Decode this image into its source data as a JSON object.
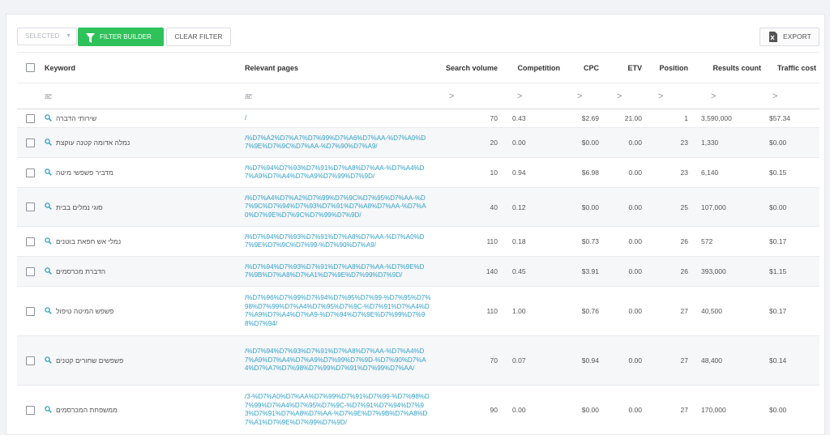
{
  "toolbar": {
    "selected_label": "SELECTED",
    "filter_builder_label": "FILTER BUILDER",
    "clear_filter_label": "CLEAR FILTER",
    "export_label": "EXPORT"
  },
  "columns": {
    "keyword": "Keyword",
    "relevant_pages": "Relevant pages",
    "search_volume": "Search volume",
    "competition": "Competition",
    "cpc": "CPC",
    "etv": "ETV",
    "position": "Position",
    "results_count": "Results count",
    "traffic_cost": "Traffic cost"
  },
  "filters": {
    "text_glyph": "a͞c",
    "num_glyph": ">"
  },
  "colors": {
    "accent_green": "#2fc25b",
    "link_blue": "#2f9fc6"
  },
  "rows": [
    {
      "keyword": "שירותי הדברה",
      "page": "/",
      "search_volume": "70",
      "competition": "0.43",
      "cpc": "$2.69",
      "etv": "21.00",
      "position": "1",
      "results_count": "3,590,000",
      "traffic_cost": "$57.34"
    },
    {
      "keyword": "נמלה אדומה קטנה עוקצת",
      "page": "/%D7%A2%D7%A7%D7%99%D7%A6%D7%AA-%D7%A0%D7%9E%D7%9C%D7%AA-%D7%90%D7%A9/",
      "search_volume": "20",
      "competition": "0.00",
      "cpc": "$0.00",
      "etv": "0.00",
      "position": "23",
      "results_count": "1,330",
      "traffic_cost": "$0.00"
    },
    {
      "keyword": "מדביר פשפשי מיטה",
      "page": "/%D7%94%D7%93%D7%91%D7%A8%D7%AA-%D7%A4%D7%A9%D7%A4%D7%A9%D7%99%D7%9D/",
      "search_volume": "10",
      "competition": "0.94",
      "cpc": "$6.98",
      "etv": "0.00",
      "position": "23",
      "results_count": "6,140",
      "traffic_cost": "$0.15"
    },
    {
      "keyword": "סוגי נמלים בבית",
      "page": "/%D7%A4%D7%A2%D7%99%D7%9C%D7%95%D7%AA-%D7%9C%D7%94%D7%93%D7%91%D7%A8%D7%AA-%D7%A0%D7%9E%D7%9C%D7%99%D7%9D/",
      "search_volume": "40",
      "competition": "0.12",
      "cpc": "$0.00",
      "etv": "0.00",
      "position": "25",
      "results_count": "107,000",
      "traffic_cost": "$0.00"
    },
    {
      "keyword": "נמלי אש חפאת בוטנים",
      "page": "/%D7%94%D7%93%D7%91%D7%A8%D7%AA-%D7%A0%D7%9E%D7%9C%D7%99-%D7%90%D7%A9/",
      "search_volume": "110",
      "competition": "0.18",
      "cpc": "$0.73",
      "etv": "0.00",
      "position": "26",
      "results_count": "572",
      "traffic_cost": "$0.17"
    },
    {
      "keyword": "הדברת מכרסמים",
      "page": "/%D7%94%D7%93%D7%91%D7%A8%D7%AA-%D7%9E%D7%9B%D7%A8%D7%A1%D7%9E%D7%99%D7%9D/",
      "search_volume": "140",
      "competition": "0.45",
      "cpc": "$3.91",
      "etv": "0.00",
      "position": "26",
      "results_count": "393,000",
      "traffic_cost": "$1.15"
    },
    {
      "keyword": "פשפש המיטה טיפול",
      "page": "/%D7%96%D7%99%D7%94%D7%95%D7%99-%D7%95%D7%98%D7%99%D7%A4%D7%95%D7%9C-%D7%91%D7%A4%D7%A9%D7%A4%D7%A9-%D7%94%D7%9E%D7%99%D7%98%D7%94/",
      "search_volume": "110",
      "competition": "1.00",
      "cpc": "$0.76",
      "etv": "0.00",
      "position": "27",
      "results_count": "40,500",
      "traffic_cost": "$0.17"
    },
    {
      "keyword": "פשפשים שחורים קטנים",
      "page": "/%D7%94%D7%93%D7%91%D7%A8%D7%AA-%D7%A4%D7%A9%D7%A4%D7%A9%D7%99%D7%9D-%D7%90%D7%A4%D7%A7%D7%98%D7%99%D7%91%D7%99%D7%AA/",
      "search_volume": "70",
      "competition": "0.07",
      "cpc": "$0.94",
      "etv": "0.00",
      "position": "27",
      "results_count": "48,400",
      "traffic_cost": "$0.14"
    },
    {
      "keyword": "ממשפחת המכרסמים",
      "page": "/3-%D7%A0%D7%AA%D7%99%D7%91%D7%99-%D7%98%D7%99%D7%A4%D7%95%D7%9C-%D7%91%D7%94%D7%93%D7%91%D7%A8%D7%AA-%D7%9E%D7%9B%D7%A8%D7%A1%D7%9E%D7%99%D7%9D/",
      "search_volume": "90",
      "competition": "0.00",
      "cpc": "$0.00",
      "etv": "0.00",
      "position": "27",
      "results_count": "170,000",
      "traffic_cost": "$0.00"
    }
  ]
}
